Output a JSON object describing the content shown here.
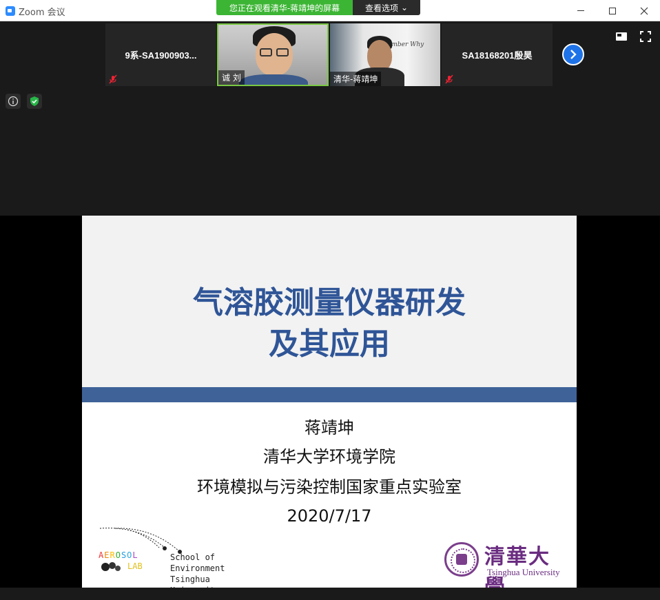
{
  "window": {
    "title": "Zoom 会议",
    "share_banner": "您正在观看清华-蒋靖坤的屏幕",
    "view_options": "查看选项",
    "view_options_caret": "⌄"
  },
  "participants": [
    {
      "name": "9系-SA1900903...",
      "muted": true
    },
    {
      "name": "诚 刘",
      "muted": false
    },
    {
      "name": "清华-蒋靖坤",
      "muted": false
    },
    {
      "name": "SA18168201殷昊",
      "muted": true
    }
  ],
  "video_wall_text": "ember Why",
  "slide": {
    "title_line1": "气溶胶测量仪器研发",
    "title_line2": "及其应用",
    "author": "蒋靖坤",
    "school": "清华大学环境学院",
    "lab": "环境模拟与污染控制国家重点实验室",
    "date": "2020/7/17",
    "aerosol_letters": [
      "A",
      "E",
      "R",
      "O",
      "S",
      "O",
      "L"
    ],
    "aerosol_colors": [
      "#e33",
      "#e80",
      "#fb0",
      "#3a3",
      "#29d",
      "#2ad",
      "#a4c"
    ],
    "lab_word": "LAB",
    "school_en_line1": "School of Environment",
    "school_en_line2": "Tsinghua University",
    "thu_name_cn": "清華大學",
    "thu_name_en": "Tsinghua University"
  },
  "icons": [
    "zoom-logo-icon",
    "minimize-icon",
    "maximize-icon",
    "close-icon",
    "mute-icon",
    "next-page-icon",
    "speaker-view-icon",
    "fullscreen-icon",
    "info-icon",
    "shield-icon"
  ],
  "colors": {
    "share_banner": "#3cb534",
    "slide_title": "#2f5597",
    "slide_band": "#3f6399",
    "next_button": "#1f73e8",
    "active_speaker_border": "#7ac943"
  }
}
